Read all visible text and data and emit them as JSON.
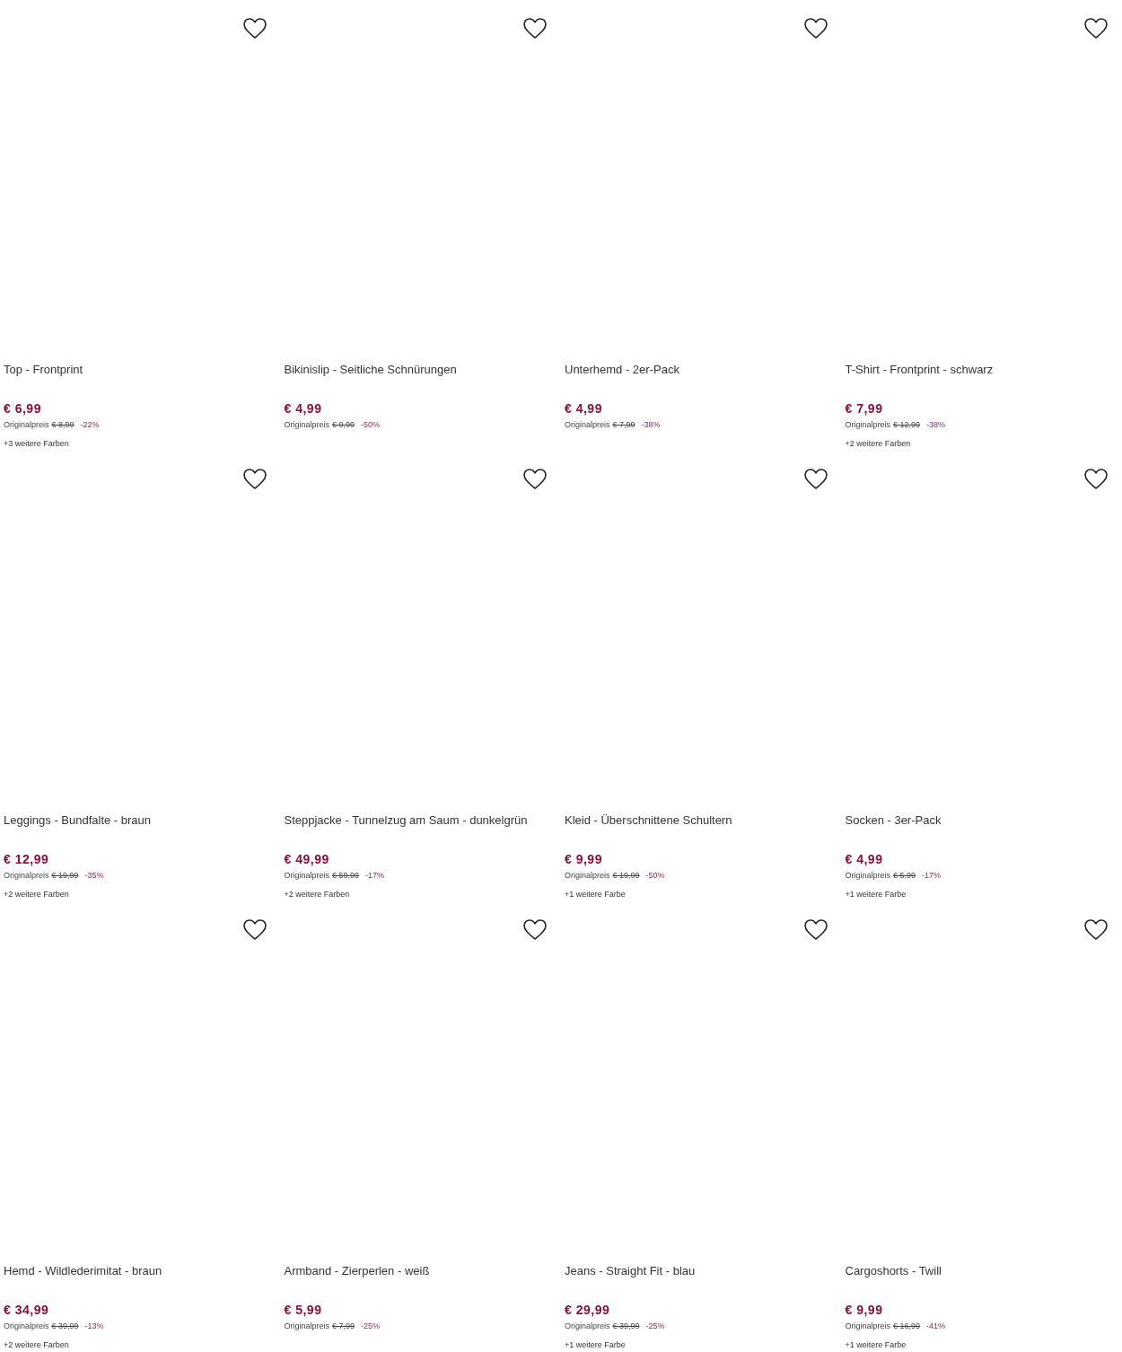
{
  "products": [
    {
      "title": "Top - Frontprint",
      "price": "€ 6,99",
      "original_label": "Originalpreis",
      "original_price": "€ 8,99",
      "discount": "-22%",
      "more_colors": "+3 weitere Farben"
    },
    {
      "title": "Bikinislip - Seitliche Schnürungen",
      "price": "€ 4,99",
      "original_label": "Originalpreis",
      "original_price": "€ 9,99",
      "discount": "-50%"
    },
    {
      "title": "Unterhemd - 2er-Pack",
      "price": "€ 4,99",
      "original_label": "Originalpreis",
      "original_price": "€ 7,99",
      "discount": "-38%"
    },
    {
      "title": "T-Shirt - Frontprint - schwarz",
      "price": "€ 7,99",
      "original_label": "Originalpreis",
      "original_price": "€ 12,99",
      "discount": "-38%",
      "more_colors": "+2 weitere Farben"
    },
    {
      "title": "Leggings - Bundfalte - braun",
      "price": "€ 12,99",
      "original_label": "Originalpreis",
      "original_price": "€ 19,99",
      "discount": "-35%",
      "more_colors": "+2 weitere Farben"
    },
    {
      "title": "Steppjacke - Tunnelzug am Saum - dunkelgrün",
      "price": "€ 49,99",
      "original_label": "Originalpreis",
      "original_price": "€ 59,99",
      "discount": "-17%",
      "more_colors": "+2 weitere Farben"
    },
    {
      "title": "Kleid - Überschnittene Schultern",
      "price": "€ 9,99",
      "original_label": "Originalpreis",
      "original_price": "€ 19,99",
      "discount": "-50%",
      "more_colors": "+1 weitere Farbe"
    },
    {
      "title": "Socken - 3er-Pack",
      "price": "€ 4,99",
      "original_label": "Originalpreis",
      "original_price": "€ 5,99",
      "discount": "-17%",
      "more_colors": "+1 weitere Farbe"
    },
    {
      "title": "Hemd - Wildlederimitat - braun",
      "price": "€ 34,99",
      "original_label": "Originalpreis",
      "original_price": "€ 39,99",
      "discount": "-13%",
      "more_colors": "+2 weitere Farben"
    },
    {
      "title": "Armband - Zierperlen - weiß",
      "price": "€ 5,99",
      "original_label": "Originalpreis",
      "original_price": "€ 7,99",
      "discount": "-25%"
    },
    {
      "title": "Jeans - Straight Fit - blau",
      "price": "€ 29,99",
      "original_label": "Originalpreis",
      "original_price": "€ 39,99",
      "discount": "-25%",
      "more_colors": "+1 weitere Farbe"
    },
    {
      "title": "Cargoshorts - Twill",
      "price": "€ 9,99",
      "original_label": "Originalpreis",
      "original_price": "€ 16,99",
      "discount": "-41%",
      "more_colors": "+1 weitere Farbe"
    }
  ]
}
